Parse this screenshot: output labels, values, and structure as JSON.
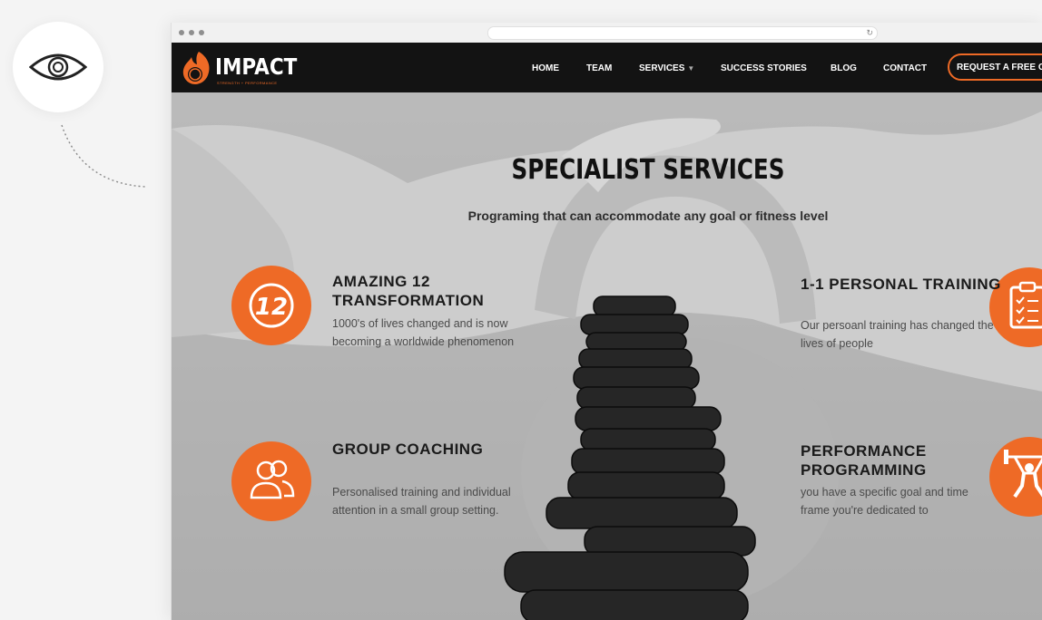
{
  "nav": {
    "logo_text": "IMPACT",
    "logo_tagline": "STRENGTH + PERFORMANCE",
    "items": [
      {
        "label": "HOME"
      },
      {
        "label": "TEAM"
      },
      {
        "label": "SERVICES"
      },
      {
        "label": "SUCCESS STORIES"
      },
      {
        "label": "BLOG"
      },
      {
        "label": "CONTACT"
      }
    ],
    "cta_label": "REQUEST A FREE C"
  },
  "hero": {
    "title": "SPECIALIST SERVICES",
    "subtitle": "Programing that can accommodate any goal or fitness level"
  },
  "services": [
    {
      "title": "AMAZING 12 TRANSFORMATION",
      "desc": "1000's of lives changed and is now becoming a worldwide phenomenon",
      "icon": "twelve-icon"
    },
    {
      "title": "1-1 PERSONAL TRAINING",
      "desc": "Our persoanl training has changed the lives of people",
      "icon": "clipboard-icon"
    },
    {
      "title": "GROUP COACHING",
      "desc": "Personalised training and individual attention in a small group setting.",
      "icon": "group-icon"
    },
    {
      "title": "PERFORMANCE PROGRAMMING",
      "desc": "you have a specific goal and time frame you're dedicated to",
      "icon": "weightlifter-icon"
    }
  ],
  "colors": {
    "accent": "#ee6a26",
    "nav_bg": "#131313",
    "text_dark": "#111111"
  }
}
